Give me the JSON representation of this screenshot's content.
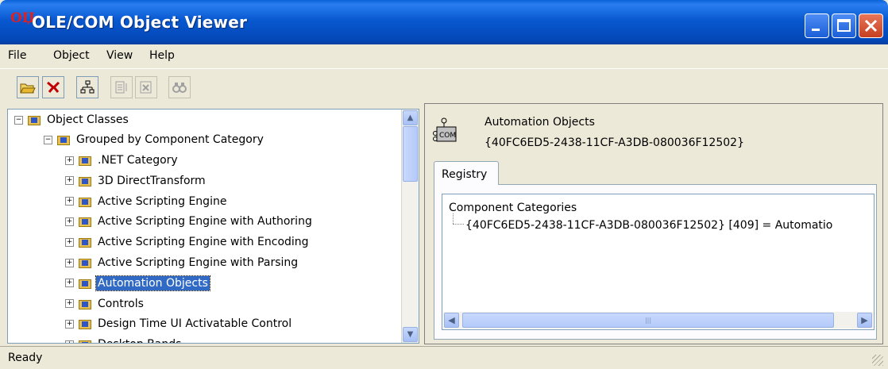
{
  "window": {
    "app_icon_text": "ОЏ",
    "title": "OLE/COM Object Viewer",
    "minimize_icon": "minimize-icon",
    "maximize_icon": "maximize-icon",
    "close_icon": "close-icon"
  },
  "menu": [
    "File",
    "Object",
    "View",
    "Help"
  ],
  "toolbar": [
    {
      "name": "open-icon",
      "enabled": true
    },
    {
      "name": "connect-icon",
      "enabled": true
    },
    {
      "name": "hierarchy-icon",
      "enabled": true
    },
    {
      "name": "create-instance-icon",
      "enabled": false
    },
    {
      "name": "release-instance-icon",
      "enabled": false
    },
    {
      "name": "view-icon",
      "enabled": false
    }
  ],
  "tree": {
    "root": "Object Classes",
    "group": "Grouped by Component Category",
    "items": [
      ".NET Category",
      "3D DirectTransform",
      "Active Scripting Engine",
      "Active Scripting Engine with Authoring",
      "Active Scripting Engine with Encoding",
      "Active Scripting Engine with Parsing",
      "Automation Objects",
      "Controls",
      "Design Time UI Activatable Control",
      "Desktop Bands"
    ],
    "selected": "Automation Objects"
  },
  "detail": {
    "title": "Automation Objects",
    "clsid": "{40FC6ED5-2438-11CF-A3DB-080036F12502}",
    "icon_label": "COM",
    "tab": "Registry",
    "registry_root": "Component Categories",
    "registry_child": "{40FC6ED5-2438-11CF-A3DB-080036F12502} [409] = Automatio"
  },
  "status": "Ready",
  "colors": {
    "titlebar": "#0858d0",
    "selection": "#316ac5",
    "face": "#ece9d8"
  }
}
